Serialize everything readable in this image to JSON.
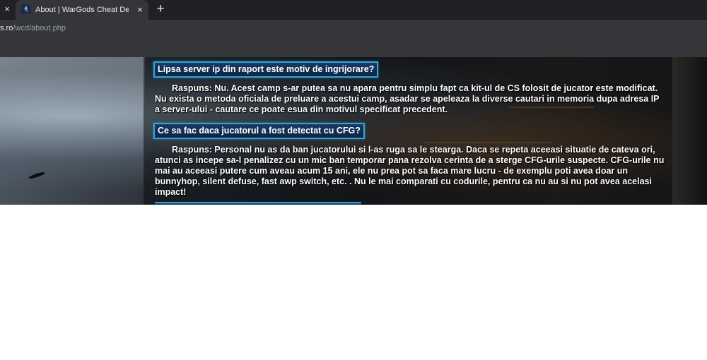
{
  "browser": {
    "tabs": [
      {
        "title": "About | WarGods Cheat Defender",
        "close_icon": "×"
      }
    ],
    "prev_tab_close_icon": "×",
    "new_tab_icon": "+",
    "url_host": "s.ro",
    "url_path": "/wcd/about.php"
  },
  "faq": [
    {
      "question": "Lipsa server ip din raport este motiv de ingrijorare?",
      "answer": "Raspuns: Nu. Acest camp s-ar putea sa nu apara pentru simplu fapt ca kit-ul de CS folosit de jucator este modificat. Nu exista o metoda oficiala de preluare a acestui camp, asadar se apeleaza la diverse cautari in memoria dupa adresa IP a server-ului - cautare ce poate esua din motivul specificat precedent."
    },
    {
      "question": "Ce sa fac daca jucatorul a fost detectat cu CFG?",
      "answer": "Raspuns: Personal nu as da ban jucatorului si l-as ruga sa le stearga. Daca se repeta aceeasi situatie de cateva ori, atunci as incepe sa-l penalizez cu un mic ban temporar pana rezolva cerinta de a sterge CFG-urile suspecte. CFG-urile nu mai au aceeasi putere cum aveau acum 15 ani, ele nu prea pot sa faca mare lucru - de exemplu poti avea doar un bunnyhop, silent defuse, fast awp switch, etc. . Nu le mai comparati cu codurile, pentru ca nu au si nu pot avea acelasi impact!"
    }
  ],
  "colors": {
    "question_border": "#2aa7d8",
    "question_bg": "#183a63",
    "browser_dark": "#202124",
    "browser_toolbar": "#35363a"
  }
}
